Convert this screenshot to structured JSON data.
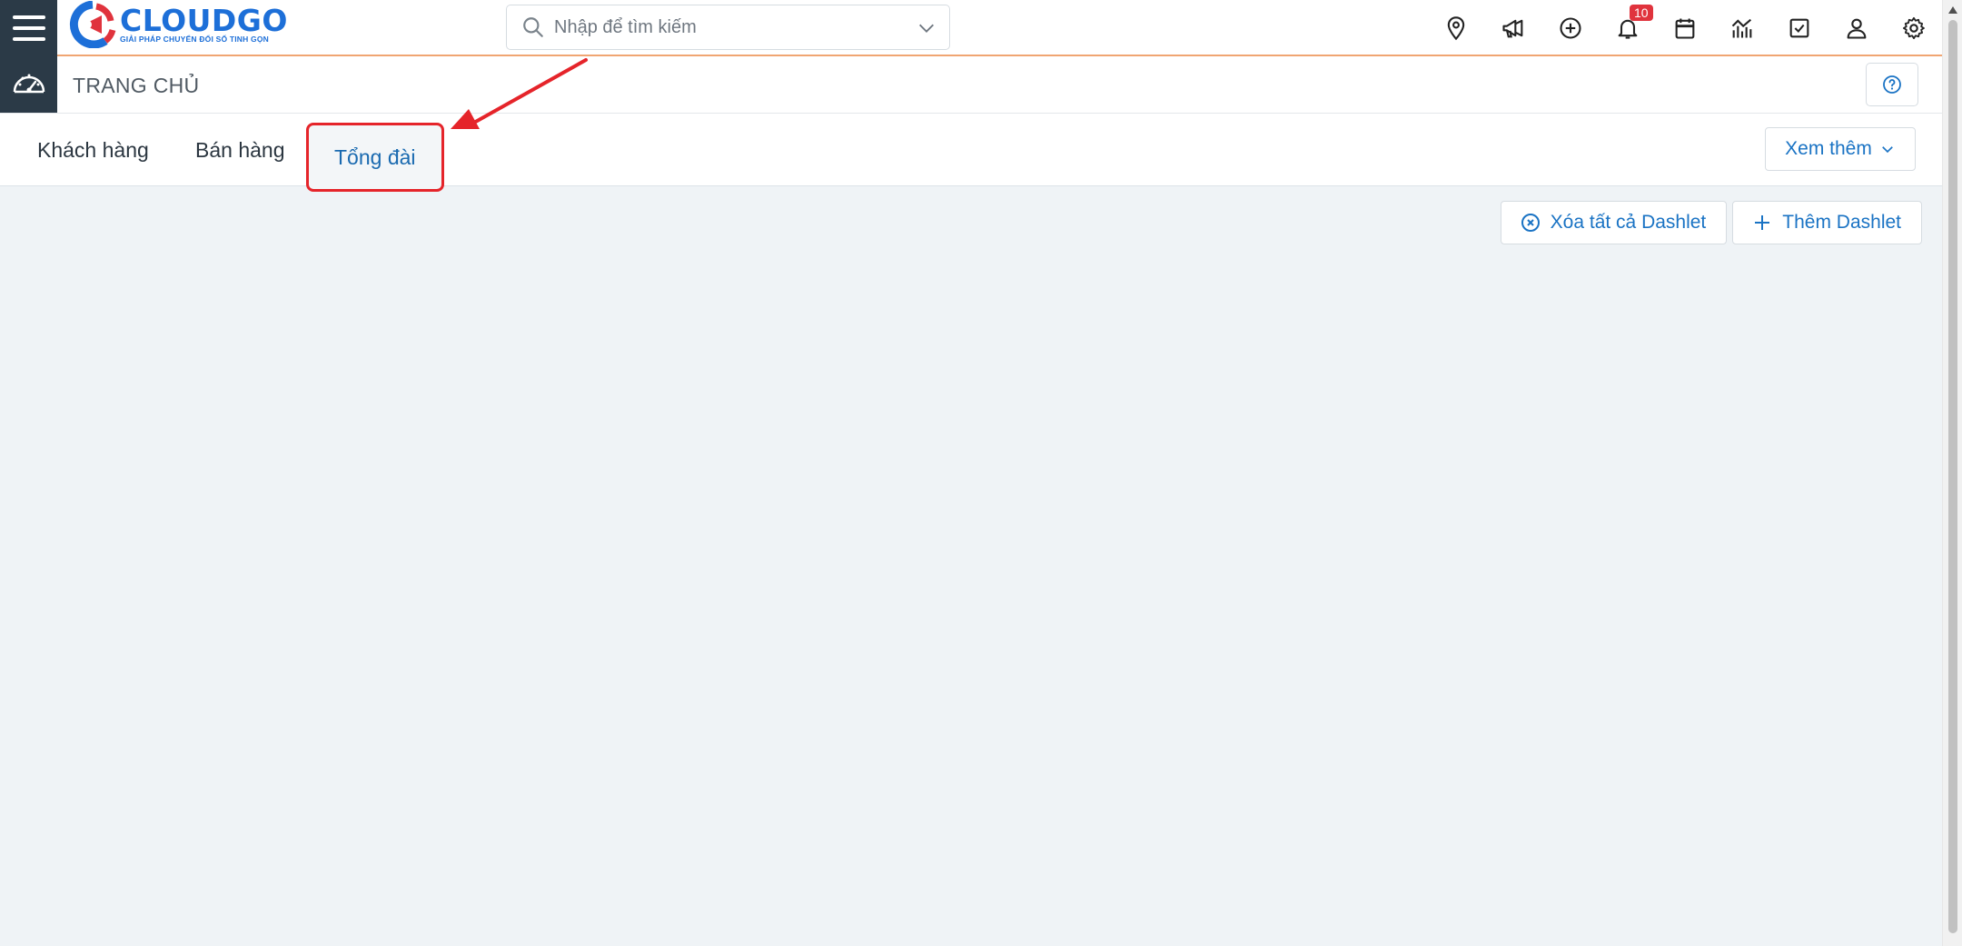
{
  "app": {
    "logo_name": "CLOUDGO",
    "logo_tagline": "GIẢI PHÁP CHUYỂN ĐỔI SỐ TINH GỌN"
  },
  "search": {
    "placeholder": "Nhập để tìm kiếm"
  },
  "topbar_icons": [
    {
      "name": "location-pin-icon"
    },
    {
      "name": "megaphone-icon"
    },
    {
      "name": "plus-circle-icon"
    },
    {
      "name": "bell-icon",
      "badge": "10"
    },
    {
      "name": "calendar-icon"
    },
    {
      "name": "chart-icon"
    },
    {
      "name": "checkbox-icon"
    },
    {
      "name": "user-icon"
    },
    {
      "name": "gear-icon"
    }
  ],
  "breadcrumb": {
    "title": "TRANG CHỦ"
  },
  "tabs": [
    {
      "label": "Khách hàng",
      "active": false
    },
    {
      "label": "Bán hàng",
      "active": false
    },
    {
      "label": "Tổng đài",
      "active": true
    }
  ],
  "more_button": {
    "label": "Xem thêm"
  },
  "actions": {
    "clear_all_label": "Xóa tất cả Dashlet",
    "add_label": "Thêm Dashlet"
  },
  "colors": {
    "brand_blue": "#1d6fd8",
    "sidebar_dark": "#2b3a47",
    "accent_orange": "#f0a572",
    "link_blue": "#1a73c4",
    "highlight_red": "#e5242a",
    "badge_red": "#e0333d",
    "background": "#eff3f6"
  }
}
